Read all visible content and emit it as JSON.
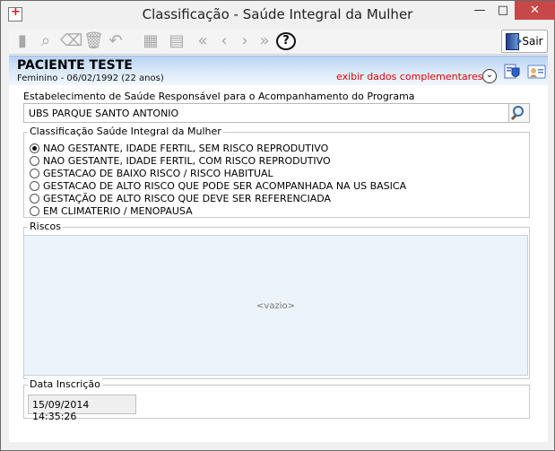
{
  "window": {
    "title": "Classificação - Saúde Integral da Mulher",
    "minimize": "—",
    "maximize": "□",
    "close": "✕"
  },
  "toolbar": {
    "exit_label": "Sair",
    "help_symbol": "?",
    "icons": [
      {
        "name": "new-icon",
        "symbol": "▮"
      },
      {
        "name": "binoculars-icon",
        "symbol": "⌕"
      },
      {
        "name": "eraser-icon",
        "symbol": "⌫"
      },
      {
        "name": "trash-icon",
        "symbol": "🗑"
      },
      {
        "name": "undo-icon",
        "symbol": "↶"
      },
      {
        "name": "save-icon",
        "symbol": "▦"
      },
      {
        "name": "print-icon",
        "symbol": "▤"
      },
      {
        "name": "first-icon",
        "symbol": "«"
      },
      {
        "name": "previous-icon",
        "symbol": "‹"
      },
      {
        "name": "next-icon",
        "symbol": "›"
      },
      {
        "name": "last-icon",
        "symbol": "»"
      }
    ]
  },
  "patient": {
    "name": "PACIENTE TESTE",
    "details": "Feminino - 06/02/1992 (22 anos)",
    "complementary_link": "exibir dados complementares...",
    "expand_symbol": "⌄"
  },
  "establishment": {
    "label": "Estabelecimento de Saúde Responsável para o Acompanhamento do Programa",
    "value": "UBS PARQUE SANTO ANTONIO"
  },
  "classification": {
    "legend": "Classificação Saúde Integral da Mulher",
    "options": [
      {
        "label": "NAO GESTANTE, IDADE FERTIL, SEM RISCO REPRODUTIVO",
        "selected": true
      },
      {
        "label": "NAO GESTANTE, IDADE FERTIL, COM RISCO REPRODUTIVO",
        "selected": false
      },
      {
        "label": "GESTACAO DE BAIXO RISCO / RISCO HABITUAL",
        "selected": false
      },
      {
        "label": "GESTACAO DE ALTO RISCO QUE PODE SER ACOMPANHADA NA US BASICA",
        "selected": false
      },
      {
        "label": "GESTAÇÃO DE ALTO RISCO QUE DEVE SER REFERENCIADA",
        "selected": false
      },
      {
        "label": "EM CLIMATERIO / MENOPAUSA",
        "selected": false
      }
    ]
  },
  "risks": {
    "legend": "Riscos",
    "empty_text": "<vazio>"
  },
  "registration": {
    "legend": "Data Inscrição",
    "value": "15/09/2014 14:35:26"
  },
  "colors": {
    "accent_red": "#e00000",
    "panel_blue": "#ecf3f9",
    "close_red": "#c74848"
  }
}
